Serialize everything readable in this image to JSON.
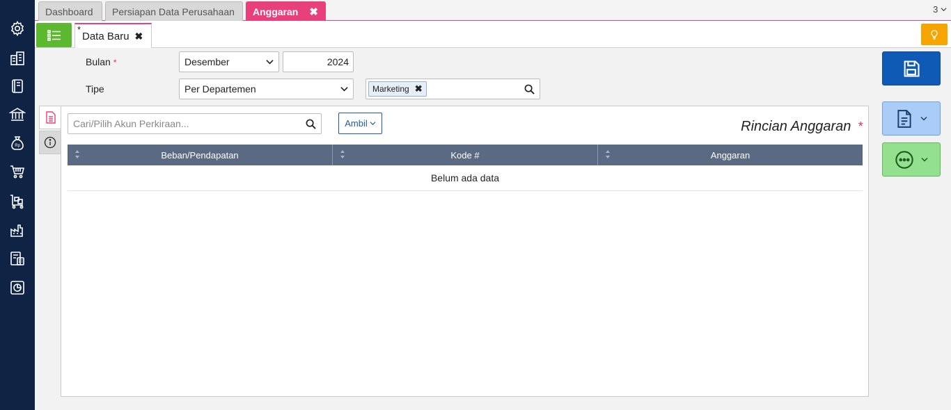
{
  "sidebar": {
    "icons": [
      "gear-icon",
      "building-icon",
      "book-icon",
      "bank-icon",
      "money-bag-icon",
      "cart-icon",
      "delivery-cart-icon",
      "factory-icon",
      "tax-calculator-icon",
      "report-chart-icon"
    ]
  },
  "tabs": [
    {
      "label": "Dashboard"
    },
    {
      "label": "Persiapan Data Perusahaan"
    },
    {
      "label": "Anggaran",
      "close": "✖"
    }
  ],
  "tab_count": "3",
  "doc_tab": {
    "label": "Data Baru",
    "modified": "*",
    "close": "✖"
  },
  "form": {
    "bulan_label": "Bulan",
    "bulan_value": "Desember",
    "tahun_value": "2024",
    "tipe_label": "Tipe",
    "tipe_value": "Per Departemen",
    "department_chip": "Marketing",
    "required": "*"
  },
  "panel": {
    "search_placeholder": "Cari/Pilih Akun Perkiraan...",
    "ambil_label": "Ambil",
    "title": "Rincian Anggaran",
    "columns": [
      "Beban/Pendapatan",
      "Kode #",
      "Anggaran"
    ],
    "empty_text": "Belum ada data"
  },
  "colors": {
    "sidebar": "#0f2344",
    "accent_pink": "#e8407a",
    "green": "#5cb82f",
    "save_blue": "#0f5ab4",
    "orange": "#f6a400"
  }
}
